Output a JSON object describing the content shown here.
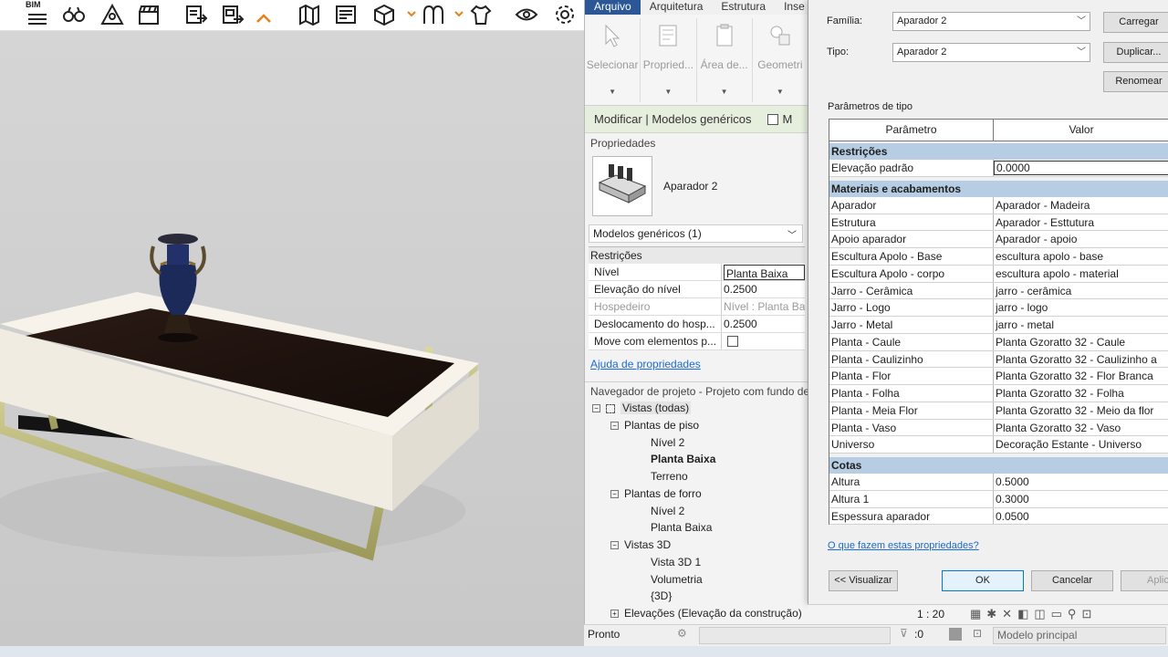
{
  "toolbar": {
    "bim_label": "BIM",
    "icons": [
      "menu-icon",
      "binoculars-icon",
      "triangle-eye-icon",
      "clapper-icon",
      "export-icon",
      "export-list-icon",
      "collapse-icon",
      "map-icon",
      "image-icon",
      "cube-icon",
      "arch-icon",
      "shirt-icon",
      "eye-icon",
      "gear-icon"
    ]
  },
  "ribbon": {
    "tabs": [
      "Arquivo",
      "Arquitetura",
      "Estrutura",
      "Inse"
    ],
    "buttons": [
      "Selecionar",
      "Propried...",
      "Área de...",
      "Geometri"
    ]
  },
  "context": {
    "title": "Modificar | Modelos genéricos",
    "trail": "M"
  },
  "properties": {
    "title": "Propriedades",
    "type_name": "Aparador 2",
    "selector": "Modelos genéricos (1)",
    "group": "Restrições",
    "rows": [
      {
        "k": "Nível",
        "v": "Planta Baixa"
      },
      {
        "k": "Elevação do nível",
        "v": "0.2500"
      },
      {
        "k": "Hospedeiro",
        "v": "Nível : Planta Bai"
      },
      {
        "k": "Deslocamento do hosp...",
        "v": "0.2500"
      },
      {
        "k": "Move com elementos p...",
        "v": ""
      }
    ],
    "help": "Ajuda de propriedades"
  },
  "navigator": {
    "title": "Navegador de projeto - Projeto com fundo de",
    "nodes": [
      {
        "label": "Vistas (todas)",
        "toggle": "−"
      },
      {
        "label": "Plantas de piso",
        "toggle": "−"
      },
      {
        "label": "Nível 2"
      },
      {
        "label": "Planta Baixa"
      },
      {
        "label": "Terreno"
      },
      {
        "label": "Plantas de forro",
        "toggle": "−"
      },
      {
        "label": "Nível 2"
      },
      {
        "label": "Planta Baixa"
      },
      {
        "label": "Vistas 3D",
        "toggle": "−"
      },
      {
        "label": "Vista 3D 1"
      },
      {
        "label": "Volumetria"
      },
      {
        "label": "{3D}"
      },
      {
        "label": "Elevações (Elevação da construção)",
        "toggle": "+"
      }
    ]
  },
  "status": {
    "ready": "Pronto",
    "scale": "1 : 20",
    "zero": ":0",
    "model": "Modelo principal"
  },
  "dialog": {
    "familia_label": "Família:",
    "familia_value": "Aparador 2",
    "tipo_label": "Tipo:",
    "tipo_value": "Aparador 2",
    "carregar": "Carregar",
    "duplicar": "Duplicar...",
    "renomear": "Renomear",
    "params_label": "Parâmetros de tipo",
    "col_param": "Parâmetro",
    "col_value": "Valor",
    "groups": [
      {
        "name": "Restrições",
        "rows": [
          {
            "k": "Elevação padrão",
            "v": "0.0000"
          }
        ]
      },
      {
        "name": "Materiais e acabamentos",
        "rows": [
          {
            "k": "Aparador",
            "v": "Aparador - Madeira"
          },
          {
            "k": "Estrutura",
            "v": "Aparador - Esttutura"
          },
          {
            "k": "Apoio aparador",
            "v": "Aparador - apoio"
          },
          {
            "k": "Escultura Apolo - Base",
            "v": "escultura apolo - base"
          },
          {
            "k": "Escultura Apolo - corpo",
            "v": "escultura apolo - material"
          },
          {
            "k": "Jarro - Cerâmica",
            "v": "jarro - cerâmica"
          },
          {
            "k": "Jarro - Logo",
            "v": "jarro - logo"
          },
          {
            "k": "Jarro - Metal",
            "v": "jarro - metal"
          },
          {
            "k": "Planta - Caule",
            "v": "Planta Gzoratto 32 - Caule"
          },
          {
            "k": "Planta - Caulizinho",
            "v": "Planta Gzoratto 32 - Caulizinho a"
          },
          {
            "k": "Planta - Flor",
            "v": "Planta Gzoratto 32 - Flor Branca"
          },
          {
            "k": "Planta - Folha",
            "v": "Planta Gzoratto 32 - Folha"
          },
          {
            "k": "Planta - Meia Flor",
            "v": "Planta Gzoratto 32 - Meio da flor"
          },
          {
            "k": "Planta - Vaso",
            "v": "Planta Gzoratto 32 - Vaso"
          },
          {
            "k": "Universo",
            "v": "Decoração Estante - Universo"
          }
        ]
      },
      {
        "name": "Cotas",
        "rows": [
          {
            "k": "Altura",
            "v": "0.5000"
          },
          {
            "k": "Altura 1",
            "v": "0.3000"
          },
          {
            "k": "Espessura aparador",
            "v": "0.0500"
          }
        ]
      }
    ],
    "help": "O que fazem estas propriedades?",
    "preview": "<< Visualizar",
    "ok": "OK",
    "cancel": "Cancelar",
    "apply": "Aplica"
  }
}
